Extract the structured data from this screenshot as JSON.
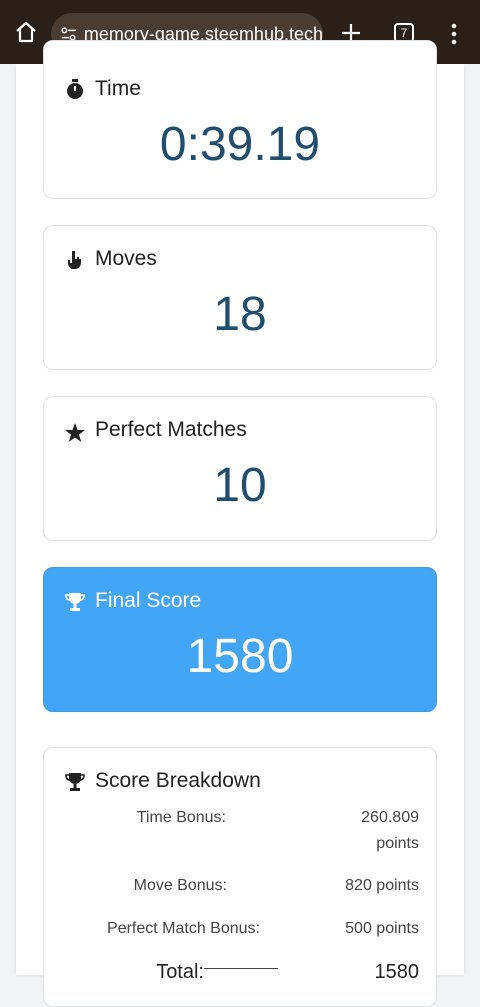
{
  "browser": {
    "url": "memory-game.steemhub.tech",
    "tab_count": "7"
  },
  "stats": {
    "time": {
      "label": "Time",
      "value": "0:39.19"
    },
    "moves": {
      "label": "Moves",
      "value": "18"
    },
    "perfect": {
      "label": "Perfect Matches",
      "value": "10"
    },
    "final": {
      "label": "Final Score",
      "value": "1580"
    }
  },
  "breakdown": {
    "title": "Score Breakdown",
    "time_bonus_label": "Time Bonus:",
    "time_bonus_value_1": "260.809",
    "time_bonus_value_2": "points",
    "move_bonus_label": "Move Bonus:",
    "move_bonus_value": "820 points",
    "perfect_bonus_label": "Perfect Match Bonus:",
    "perfect_bonus_value": "500 points",
    "total_label": "Total:",
    "total_value": "1580"
  },
  "colors": {
    "accent": "#42a5f5",
    "value_text": "#1f4e6e",
    "topbar": "#2b2017"
  }
}
